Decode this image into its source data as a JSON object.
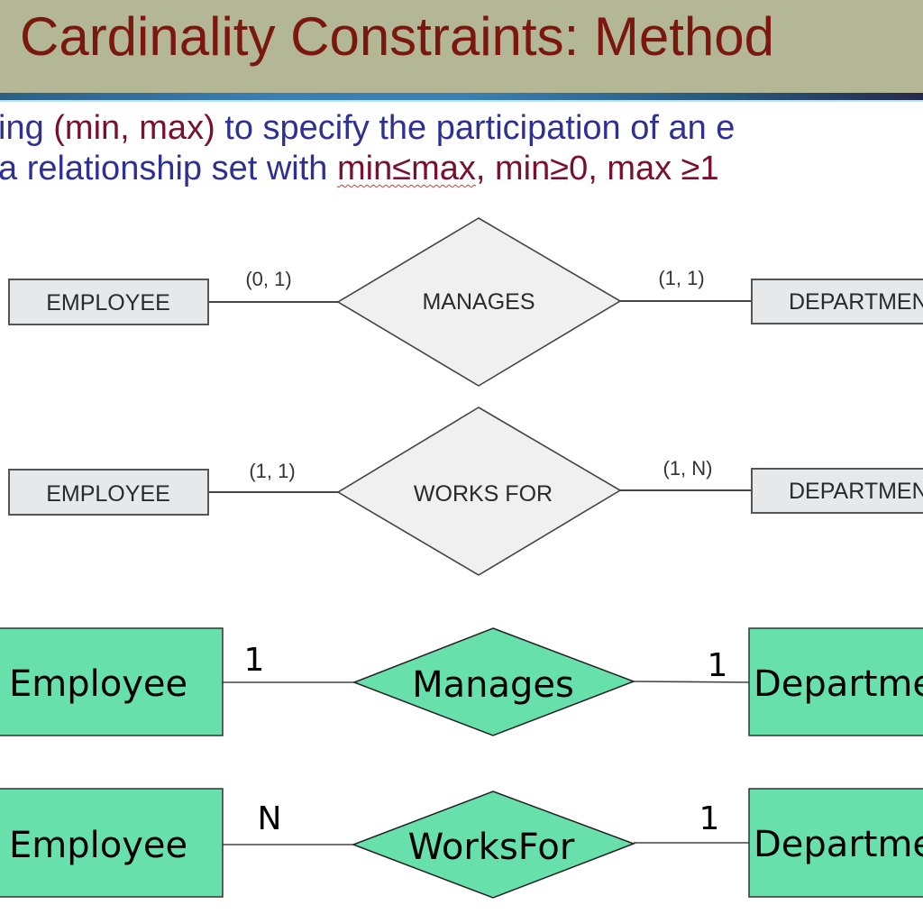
{
  "slide": {
    "title": "Cardinality Constraints: Method",
    "line1": {
      "part1": "ing ",
      "part2": "(min, max)",
      "part3": " to specify the participation of an e"
    },
    "line2": {
      "part1": "a relationship set with ",
      "part2": "min≤max",
      "part3": ", ",
      "part4": "min≥0, max ≥1"
    }
  },
  "colors": {
    "header_bg": "#b3b796",
    "title": "#7a1810",
    "body_text": "#2e3192",
    "highlight_text": "#7a1030",
    "entity_gray": "#e7e8e9",
    "entity_green": "#68e0ab"
  },
  "diagrams": [
    {
      "style": "chen-minmax",
      "left_entity": "EMPLOYEE",
      "relationship": "MANAGES",
      "right_entity": "DEPARTMENT",
      "left_card": "(0, 1)",
      "right_card": "(1, 1)"
    },
    {
      "style": "chen-minmax",
      "left_entity": "EMPLOYEE",
      "relationship": "WORKS FOR",
      "right_entity": "DEPARTMENT",
      "left_card": "(1, 1)",
      "right_card": "(1, N)"
    },
    {
      "style": "chen-ratio",
      "left_entity": "Employee",
      "relationship": "Manages",
      "right_entity": "Department",
      "left_card": "1",
      "right_card": "1"
    },
    {
      "style": "chen-ratio",
      "left_entity": "Employee",
      "relationship": "WorksFor",
      "right_entity": "Department",
      "left_card": "N",
      "right_card": "1"
    }
  ]
}
